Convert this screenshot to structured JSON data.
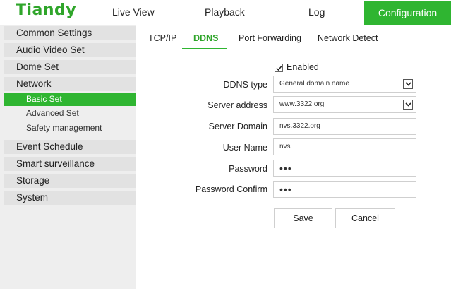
{
  "header": {
    "logo": "Tiandy",
    "nav": [
      "Live View",
      "Playback",
      "Log"
    ],
    "active_nav": "Configuration"
  },
  "sidebar": {
    "items": [
      {
        "label": "Common Settings"
      },
      {
        "label": "Audio Video Set"
      },
      {
        "label": "Dome Set"
      },
      {
        "label": "Network"
      },
      {
        "label": "Event Schedule"
      },
      {
        "label": "Smart surveillance"
      },
      {
        "label": "Storage"
      },
      {
        "label": "System"
      }
    ],
    "network_sub": [
      {
        "label": "Basic Set",
        "active": true
      },
      {
        "label": "Advanced Set",
        "active": false
      },
      {
        "label": "Safety management",
        "active": false
      }
    ]
  },
  "tabs": [
    "TCP/IP",
    "DDNS",
    "Port Forwarding",
    "Network Detect"
  ],
  "active_tab": "DDNS",
  "form": {
    "enabled_label": "Enabled",
    "enabled": true,
    "ddns_type_label": "DDNS type",
    "ddns_type_value": "General domain name",
    "server_address_label": "Server address",
    "server_address_value": "www.3322.org",
    "server_domain_label": "Server Domain",
    "server_domain_value": "nvs.3322.org",
    "user_name_label": "User Name",
    "user_name_value": "nvs",
    "password_label": "Password",
    "password_value": "•••",
    "password_confirm_label": "Password Confirm",
    "password_confirm_value": "•••"
  },
  "buttons": {
    "save": "Save",
    "cancel": "Cancel"
  },
  "colors": {
    "brand_green": "#2fb531",
    "logo_green": "#2fa52a"
  }
}
